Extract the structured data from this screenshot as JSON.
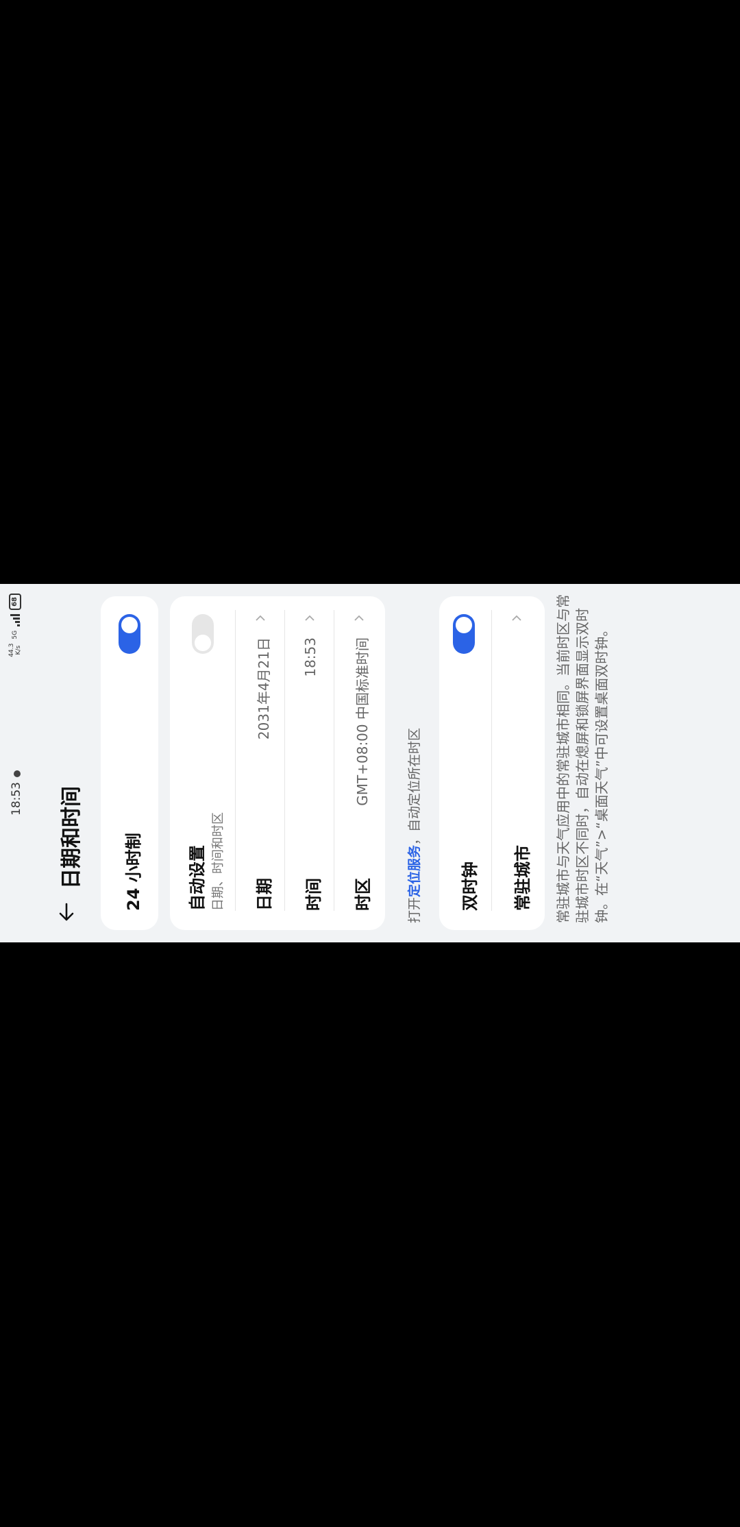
{
  "status_bar": {
    "time": "18:53",
    "net_speed_value": "44.3",
    "net_speed_unit": "K/s",
    "network_type": "5G",
    "battery": "68"
  },
  "header": {
    "title": "日期和时间",
    "back_icon": "back-arrow-icon"
  },
  "card_24h": {
    "label": "24 小时制",
    "enabled": true
  },
  "card_datetime": {
    "auto": {
      "label": "自动设置",
      "sublabel": "日期、时间和时区",
      "enabled": false
    },
    "date": {
      "label": "日期",
      "value": "2031年4月21日"
    },
    "time": {
      "label": "时间",
      "value": "18:53"
    },
    "timezone": {
      "label": "时区",
      "value": "GMT+08:00 中国标准时间"
    }
  },
  "location_note": {
    "prefix": "打开",
    "link": "定位服务",
    "suffix": "，自动定位所在时区"
  },
  "card_dual": {
    "dual_clock": {
      "label": "双时钟",
      "enabled": true
    },
    "home_city": {
      "label": "常驻城市",
      "value": ""
    }
  },
  "footnote": "常驻城市与天气应用中的常驻城市相同。当前时区与常驻城市时区不同时，自动在熄屏和锁屏界面显示双时钟。在“天气”>“桌面天气”中可设置桌面双时钟。",
  "colors": {
    "accent": "#2b63e6",
    "background": "#f1f3f5",
    "card": "#ffffff"
  }
}
